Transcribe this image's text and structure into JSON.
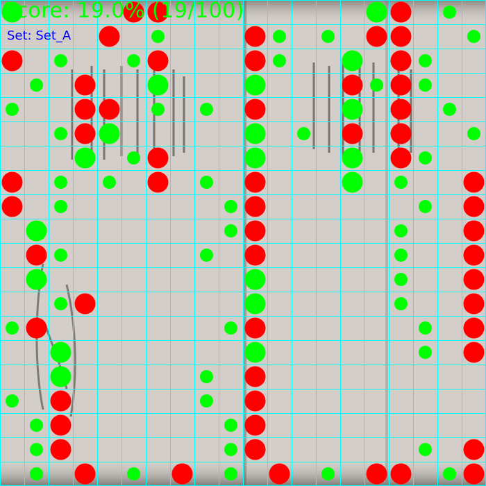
{
  "colors": {
    "background": "#d2cdc8",
    "grid": "#00ffff",
    "hit": "#00ff00",
    "miss": "#ff0000",
    "score_text": "#00ff00",
    "set_text": "#0000ff"
  },
  "header": {
    "score": "Score: 19.0% (19/100)",
    "set": "Set: Set_A"
  },
  "board": {
    "cols": 20,
    "rows": 20,
    "shots": [
      {
        "col": 0,
        "row": 0,
        "result": "hit",
        "size": "large"
      },
      {
        "col": 5,
        "row": 0,
        "result": "miss",
        "size": "large"
      },
      {
        "col": 6,
        "row": 0,
        "result": "miss",
        "size": "large"
      },
      {
        "col": 15,
        "row": 0,
        "result": "hit",
        "size": "large"
      },
      {
        "col": 16,
        "row": 0,
        "result": "miss",
        "size": "large"
      },
      {
        "col": 18,
        "row": 0,
        "result": "hit",
        "size": "small"
      },
      {
        "col": 4,
        "row": 1,
        "result": "miss",
        "size": "large"
      },
      {
        "col": 6,
        "row": 1,
        "result": "hit",
        "size": "small"
      },
      {
        "col": 10,
        "row": 1,
        "result": "miss",
        "size": "large"
      },
      {
        "col": 11,
        "row": 1,
        "result": "hit",
        "size": "small"
      },
      {
        "col": 13,
        "row": 1,
        "result": "hit",
        "size": "small"
      },
      {
        "col": 15,
        "row": 1,
        "result": "miss",
        "size": "large"
      },
      {
        "col": 16,
        "row": 1,
        "result": "miss",
        "size": "large"
      },
      {
        "col": 19,
        "row": 1,
        "result": "hit",
        "size": "small"
      },
      {
        "col": 0,
        "row": 2,
        "result": "miss",
        "size": "large"
      },
      {
        "col": 2,
        "row": 2,
        "result": "hit",
        "size": "small"
      },
      {
        "col": 5,
        "row": 2,
        "result": "hit",
        "size": "small"
      },
      {
        "col": 6,
        "row": 2,
        "result": "miss",
        "size": "large"
      },
      {
        "col": 10,
        "row": 2,
        "result": "miss",
        "size": "large"
      },
      {
        "col": 11,
        "row": 2,
        "result": "hit",
        "size": "small"
      },
      {
        "col": 14,
        "row": 2,
        "result": "hit",
        "size": "large"
      },
      {
        "col": 16,
        "row": 2,
        "result": "miss",
        "size": "large"
      },
      {
        "col": 17,
        "row": 2,
        "result": "hit",
        "size": "small"
      },
      {
        "col": 1,
        "row": 3,
        "result": "hit",
        "size": "small"
      },
      {
        "col": 3,
        "row": 3,
        "result": "miss",
        "size": "large"
      },
      {
        "col": 6,
        "row": 3,
        "result": "hit",
        "size": "large"
      },
      {
        "col": 10,
        "row": 3,
        "result": "hit",
        "size": "large"
      },
      {
        "col": 14,
        "row": 3,
        "result": "miss",
        "size": "large"
      },
      {
        "col": 15,
        "row": 3,
        "result": "hit",
        "size": "small"
      },
      {
        "col": 16,
        "row": 3,
        "result": "miss",
        "size": "large"
      },
      {
        "col": 17,
        "row": 3,
        "result": "hit",
        "size": "small"
      },
      {
        "col": 0,
        "row": 4,
        "result": "hit",
        "size": "small"
      },
      {
        "col": 3,
        "row": 4,
        "result": "miss",
        "size": "large"
      },
      {
        "col": 4,
        "row": 4,
        "result": "miss",
        "size": "large"
      },
      {
        "col": 6,
        "row": 4,
        "result": "hit",
        "size": "small"
      },
      {
        "col": 8,
        "row": 4,
        "result": "hit",
        "size": "small"
      },
      {
        "col": 10,
        "row": 4,
        "result": "miss",
        "size": "large"
      },
      {
        "col": 14,
        "row": 4,
        "result": "hit",
        "size": "large"
      },
      {
        "col": 16,
        "row": 4,
        "result": "miss",
        "size": "large"
      },
      {
        "col": 18,
        "row": 4,
        "result": "hit",
        "size": "small"
      },
      {
        "col": 2,
        "row": 5,
        "result": "hit",
        "size": "small"
      },
      {
        "col": 3,
        "row": 5,
        "result": "miss",
        "size": "large"
      },
      {
        "col": 4,
        "row": 5,
        "result": "hit",
        "size": "large"
      },
      {
        "col": 10,
        "row": 5,
        "result": "hit",
        "size": "large"
      },
      {
        "col": 12,
        "row": 5,
        "result": "hit",
        "size": "small"
      },
      {
        "col": 14,
        "row": 5,
        "result": "miss",
        "size": "large"
      },
      {
        "col": 16,
        "row": 5,
        "result": "miss",
        "size": "large"
      },
      {
        "col": 19,
        "row": 5,
        "result": "hit",
        "size": "small"
      },
      {
        "col": 3,
        "row": 6,
        "result": "hit",
        "size": "large"
      },
      {
        "col": 5,
        "row": 6,
        "result": "hit",
        "size": "small"
      },
      {
        "col": 6,
        "row": 6,
        "result": "miss",
        "size": "large"
      },
      {
        "col": 10,
        "row": 6,
        "result": "hit",
        "size": "large"
      },
      {
        "col": 14,
        "row": 6,
        "result": "hit",
        "size": "large"
      },
      {
        "col": 16,
        "row": 6,
        "result": "miss",
        "size": "large"
      },
      {
        "col": 17,
        "row": 6,
        "result": "hit",
        "size": "small"
      },
      {
        "col": 0,
        "row": 7,
        "result": "miss",
        "size": "large"
      },
      {
        "col": 2,
        "row": 7,
        "result": "hit",
        "size": "small"
      },
      {
        "col": 4,
        "row": 7,
        "result": "hit",
        "size": "small"
      },
      {
        "col": 6,
        "row": 7,
        "result": "miss",
        "size": "large"
      },
      {
        "col": 8,
        "row": 7,
        "result": "hit",
        "size": "small"
      },
      {
        "col": 10,
        "row": 7,
        "result": "miss",
        "size": "large"
      },
      {
        "col": 14,
        "row": 7,
        "result": "hit",
        "size": "large"
      },
      {
        "col": 16,
        "row": 7,
        "result": "hit",
        "size": "small"
      },
      {
        "col": 19,
        "row": 7,
        "result": "miss",
        "size": "large"
      },
      {
        "col": 0,
        "row": 8,
        "result": "miss",
        "size": "large"
      },
      {
        "col": 2,
        "row": 8,
        "result": "hit",
        "size": "small"
      },
      {
        "col": 9,
        "row": 8,
        "result": "hit",
        "size": "small"
      },
      {
        "col": 10,
        "row": 8,
        "result": "miss",
        "size": "large"
      },
      {
        "col": 17,
        "row": 8,
        "result": "hit",
        "size": "small"
      },
      {
        "col": 19,
        "row": 8,
        "result": "miss",
        "size": "large"
      },
      {
        "col": 1,
        "row": 9,
        "result": "hit",
        "size": "large"
      },
      {
        "col": 9,
        "row": 9,
        "result": "hit",
        "size": "small"
      },
      {
        "col": 10,
        "row": 9,
        "result": "miss",
        "size": "large"
      },
      {
        "col": 16,
        "row": 9,
        "result": "hit",
        "size": "small"
      },
      {
        "col": 19,
        "row": 9,
        "result": "miss",
        "size": "large"
      },
      {
        "col": 1,
        "row": 10,
        "result": "miss",
        "size": "large"
      },
      {
        "col": 2,
        "row": 10,
        "result": "hit",
        "size": "small"
      },
      {
        "col": 8,
        "row": 10,
        "result": "hit",
        "size": "small"
      },
      {
        "col": 10,
        "row": 10,
        "result": "miss",
        "size": "large"
      },
      {
        "col": 16,
        "row": 10,
        "result": "hit",
        "size": "small"
      },
      {
        "col": 19,
        "row": 10,
        "result": "miss",
        "size": "large"
      },
      {
        "col": 1,
        "row": 11,
        "result": "hit",
        "size": "large"
      },
      {
        "col": 10,
        "row": 11,
        "result": "hit",
        "size": "large"
      },
      {
        "col": 16,
        "row": 11,
        "result": "hit",
        "size": "small"
      },
      {
        "col": 19,
        "row": 11,
        "result": "miss",
        "size": "large"
      },
      {
        "col": 2,
        "row": 12,
        "result": "hit",
        "size": "small"
      },
      {
        "col": 3,
        "row": 12,
        "result": "miss",
        "size": "large"
      },
      {
        "col": 10,
        "row": 12,
        "result": "hit",
        "size": "large"
      },
      {
        "col": 16,
        "row": 12,
        "result": "hit",
        "size": "small"
      },
      {
        "col": 19,
        "row": 12,
        "result": "miss",
        "size": "large"
      },
      {
        "col": 0,
        "row": 13,
        "result": "hit",
        "size": "small"
      },
      {
        "col": 1,
        "row": 13,
        "result": "miss",
        "size": "large"
      },
      {
        "col": 9,
        "row": 13,
        "result": "hit",
        "size": "small"
      },
      {
        "col": 10,
        "row": 13,
        "result": "miss",
        "size": "large"
      },
      {
        "col": 17,
        "row": 13,
        "result": "hit",
        "size": "small"
      },
      {
        "col": 19,
        "row": 13,
        "result": "miss",
        "size": "large"
      },
      {
        "col": 2,
        "row": 14,
        "result": "hit",
        "size": "large"
      },
      {
        "col": 10,
        "row": 14,
        "result": "hit",
        "size": "large"
      },
      {
        "col": 17,
        "row": 14,
        "result": "hit",
        "size": "small"
      },
      {
        "col": 19,
        "row": 14,
        "result": "miss",
        "size": "large"
      },
      {
        "col": 2,
        "row": 15,
        "result": "hit",
        "size": "large"
      },
      {
        "col": 8,
        "row": 15,
        "result": "hit",
        "size": "small"
      },
      {
        "col": 10,
        "row": 15,
        "result": "miss",
        "size": "large"
      },
      {
        "col": 0,
        "row": 16,
        "result": "hit",
        "size": "small"
      },
      {
        "col": 2,
        "row": 16,
        "result": "miss",
        "size": "large"
      },
      {
        "col": 8,
        "row": 16,
        "result": "hit",
        "size": "small"
      },
      {
        "col": 10,
        "row": 16,
        "result": "miss",
        "size": "large"
      },
      {
        "col": 1,
        "row": 17,
        "result": "hit",
        "size": "small"
      },
      {
        "col": 2,
        "row": 17,
        "result": "miss",
        "size": "large"
      },
      {
        "col": 9,
        "row": 17,
        "result": "hit",
        "size": "small"
      },
      {
        "col": 10,
        "row": 17,
        "result": "miss",
        "size": "large"
      },
      {
        "col": 1,
        "row": 18,
        "result": "hit",
        "size": "small"
      },
      {
        "col": 2,
        "row": 18,
        "result": "miss",
        "size": "large"
      },
      {
        "col": 9,
        "row": 18,
        "result": "hit",
        "size": "small"
      },
      {
        "col": 10,
        "row": 18,
        "result": "miss",
        "size": "large"
      },
      {
        "col": 17,
        "row": 18,
        "result": "hit",
        "size": "small"
      },
      {
        "col": 19,
        "row": 18,
        "result": "miss",
        "size": "large"
      },
      {
        "col": 1,
        "row": 19,
        "result": "hit",
        "size": "small"
      },
      {
        "col": 3,
        "row": 19,
        "result": "miss",
        "size": "large"
      },
      {
        "col": 5,
        "row": 19,
        "result": "hit",
        "size": "small"
      },
      {
        "col": 7,
        "row": 19,
        "result": "miss",
        "size": "large"
      },
      {
        "col": 9,
        "row": 19,
        "result": "hit",
        "size": "small"
      },
      {
        "col": 11,
        "row": 19,
        "result": "miss",
        "size": "large"
      },
      {
        "col": 13,
        "row": 19,
        "result": "hit",
        "size": "small"
      },
      {
        "col": 15,
        "row": 19,
        "result": "miss",
        "size": "large"
      },
      {
        "col": 16,
        "row": 19,
        "result": "miss",
        "size": "large"
      },
      {
        "col": 18,
        "row": 19,
        "result": "hit",
        "size": "small"
      },
      {
        "col": 19,
        "row": 19,
        "result": "miss",
        "size": "large"
      }
    ]
  }
}
